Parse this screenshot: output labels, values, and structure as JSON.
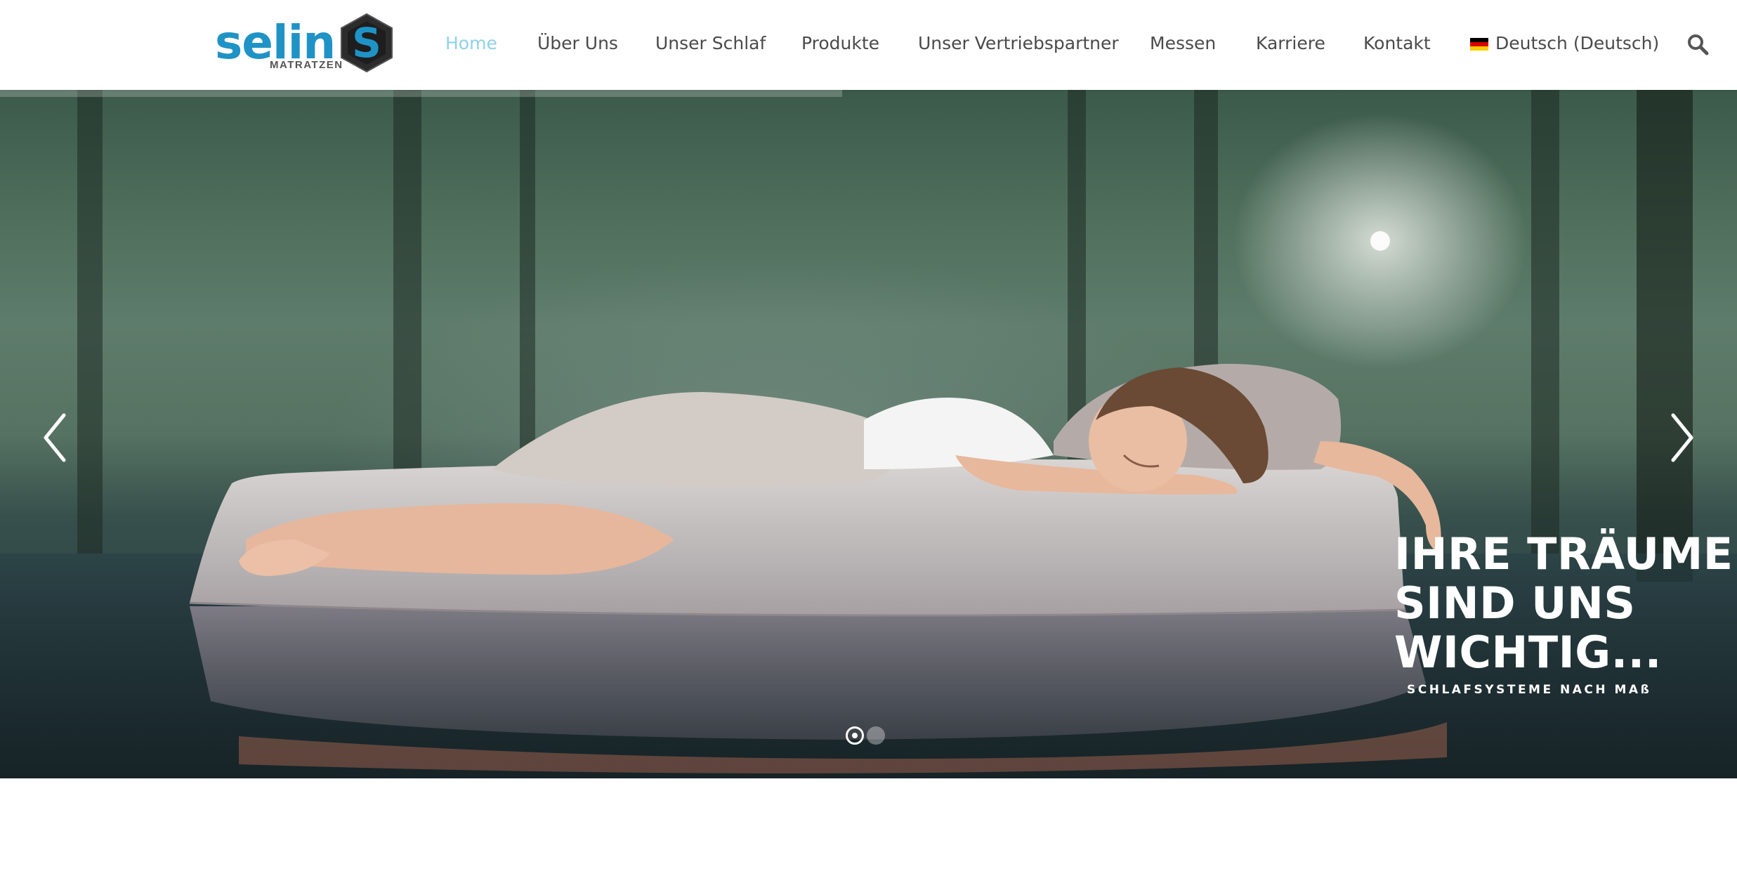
{
  "brand": {
    "name": "selin",
    "subtitle": "MATRATZEN",
    "badge_letter": "S",
    "color": "#1f93c6"
  },
  "nav": {
    "items": [
      {
        "label": "Home",
        "active": true
      },
      {
        "label": "Über Uns",
        "active": false
      },
      {
        "label": "Unser Schlaf",
        "active": false
      },
      {
        "label": "Produkte",
        "active": false
      },
      {
        "label": "Unser Vertriebspartner",
        "active": false
      },
      {
        "label": "Messen",
        "active": false
      },
      {
        "label": "Karriere",
        "active": false
      },
      {
        "label": "Kontakt",
        "active": false
      }
    ],
    "language": {
      "label": "Deutsch (Deutsch)",
      "flag_icon": "german-flag-icon"
    },
    "search_icon": "search-icon",
    "active_color": "#8fd0ea",
    "text_color": "#4a4a4a"
  },
  "hero": {
    "title_lines": [
      "IHRE TRÄUME",
      "SIND UNS",
      "WICHTIG..."
    ],
    "subtitle": "SCHLAFSYSTEME NACH MAß",
    "prev_icon": "chevron-left-icon",
    "next_icon": "chevron-right-icon",
    "slide_count": 2,
    "active_slide": 1,
    "autoplay_progress": 0.485
  }
}
